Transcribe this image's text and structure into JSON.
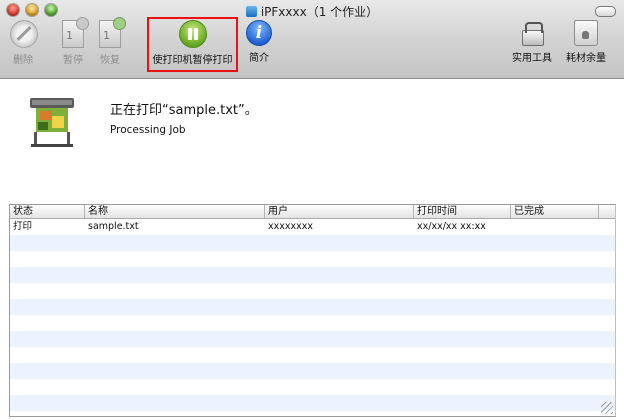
{
  "window": {
    "title": "iPFxxxx（1 个作业）"
  },
  "toolbar": {
    "delete_label": "删除",
    "hold_label": "暂停",
    "resume_label": "恢复",
    "pause_printer_label": "使打印机暂停打印",
    "info_label": "简介",
    "utility_label": "实用工具",
    "supply_label": "耗材余量"
  },
  "job": {
    "title": "正在打印“sample.txt”。",
    "status": "Processing Job"
  },
  "table": {
    "columns": [
      "状态",
      "名称",
      "用户",
      "打印时间",
      "已完成"
    ],
    "rows": [
      [
        "打印",
        "sample.txt",
        "xxxxxxxx",
        "xx/xx/xx xx:xx",
        ""
      ]
    ]
  },
  "colors": {
    "highlight": "#ee1111",
    "stripe": "#edf3fe",
    "pause_green": "#5ea31c",
    "info_blue": "#1d5fd1"
  }
}
